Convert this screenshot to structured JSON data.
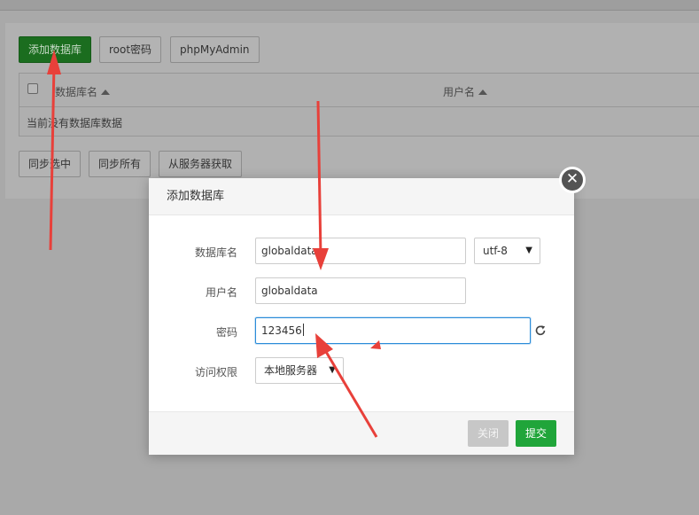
{
  "toolbar": {
    "add_db": "添加数据库",
    "root_pwd": "root密码",
    "phpmyadmin": "phpMyAdmin"
  },
  "table": {
    "col_name": "数据库名",
    "col_user": "用户名",
    "empty_text": "当前没有数据库数据"
  },
  "bottom_buttons": {
    "sync_selected": "同步选中",
    "sync_all": "同步所有",
    "fetch_from_server": "从服务器获取"
  },
  "modal": {
    "title": "添加数据库",
    "close_glyph": "✕",
    "fields": {
      "db_name_label": "数据库名",
      "db_name_value": "globaldata",
      "charset_value": "utf-8",
      "username_label": "用户名",
      "username_value": "globaldata",
      "password_label": "密码",
      "password_value": "123456",
      "access_label": "访问权限",
      "access_value": "本地服务器"
    },
    "footer": {
      "close": "关闭",
      "submit": "提交"
    }
  },
  "colors": {
    "primary_green": "#20a53a",
    "focus_blue": "#2b8cd9",
    "annotation_red": "#e8403a"
  },
  "icons": [
    "refresh-icon",
    "close-icon",
    "sort-asc-icon",
    "dropdown-arrow-icon"
  ]
}
